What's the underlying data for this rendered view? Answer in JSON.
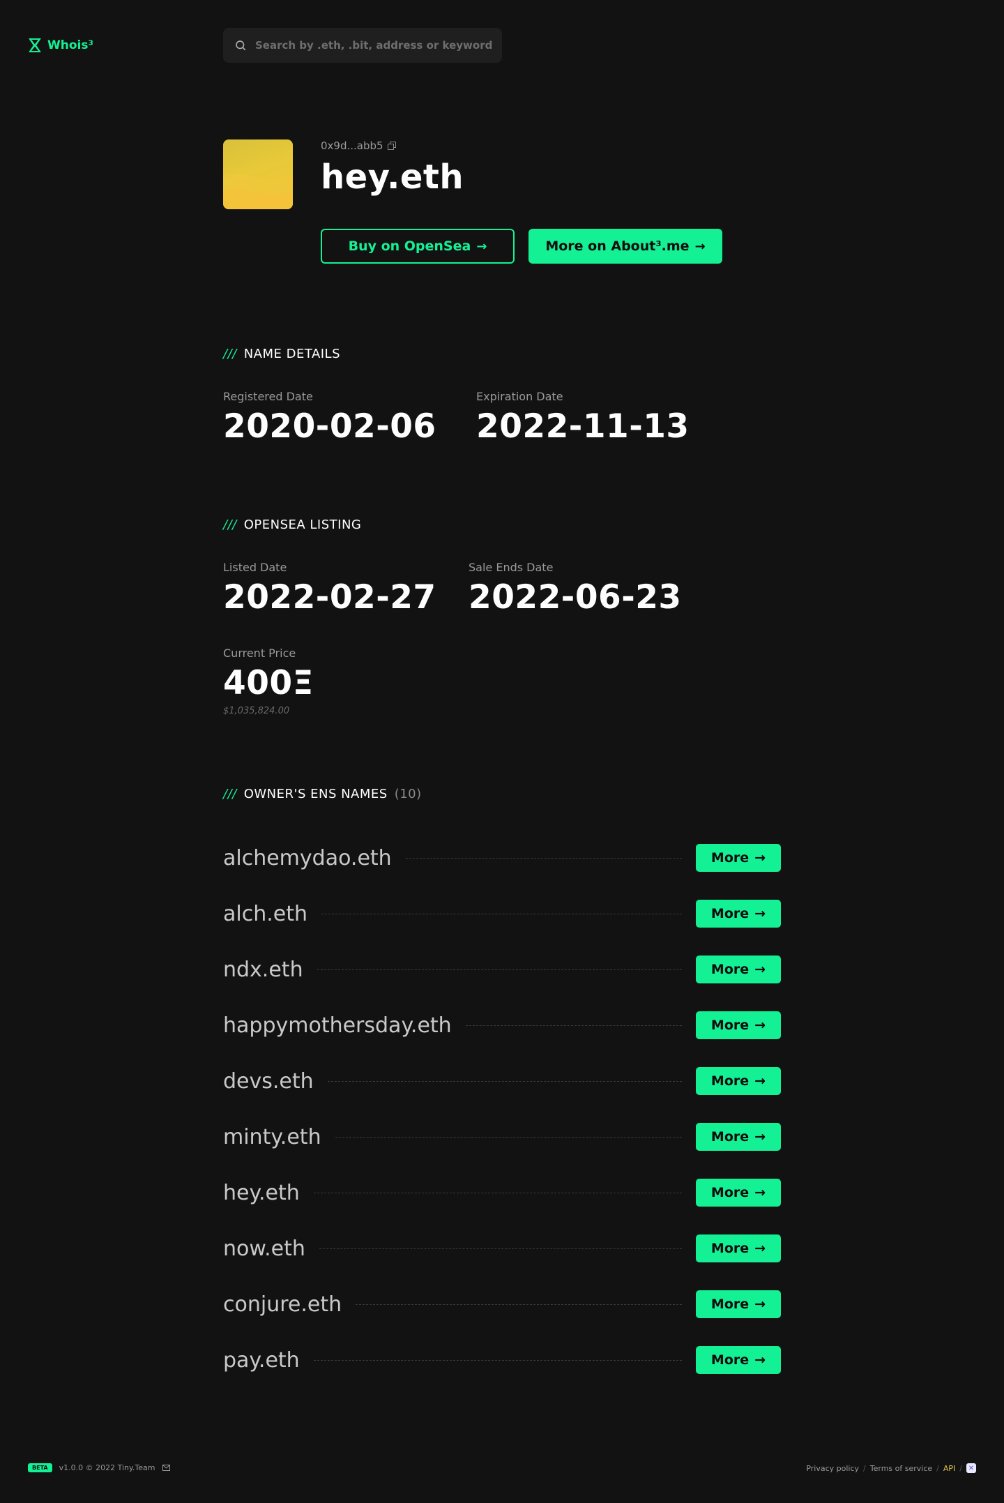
{
  "brand": {
    "name": "Whois³",
    "accent": "#14f195"
  },
  "search": {
    "placeholder": "Search by .eth, .bit, address or keyword"
  },
  "profile": {
    "address": "0x9d...abb5",
    "name": "hey.eth",
    "buy_label": "Buy on OpenSea",
    "more_label": "More on About³.me"
  },
  "name_details": {
    "title": "NAME DETAILS",
    "registered_label": "Registered Date",
    "registered_value": "2020-02-06",
    "expiration_label": "Expiration Date",
    "expiration_value": "2022-11-13"
  },
  "opensea": {
    "title": "OPENSEA LISTING",
    "listed_label": "Listed Date",
    "listed_value": "2022-02-27",
    "sale_ends_label": "Sale Ends Date",
    "sale_ends_value": "2022-06-23",
    "price_label": "Current Price",
    "price_value": "400Ξ",
    "price_usd": "$1,035,824.00"
  },
  "owner_names": {
    "title": "OWNER'S ENS NAMES",
    "count": "(10)",
    "more_label": "More",
    "items": [
      "alchemydao.eth",
      "alch.eth",
      "ndx.eth",
      "happymothersday.eth",
      "devs.eth",
      "minty.eth",
      "hey.eth",
      "now.eth",
      "conjure.eth",
      "pay.eth"
    ]
  },
  "footer": {
    "beta": "BETA",
    "version": "v1.0.0 © 2022 Tiny.Team",
    "privacy": "Privacy policy",
    "terms": "Terms of service",
    "api": "API",
    "sep": "/"
  }
}
